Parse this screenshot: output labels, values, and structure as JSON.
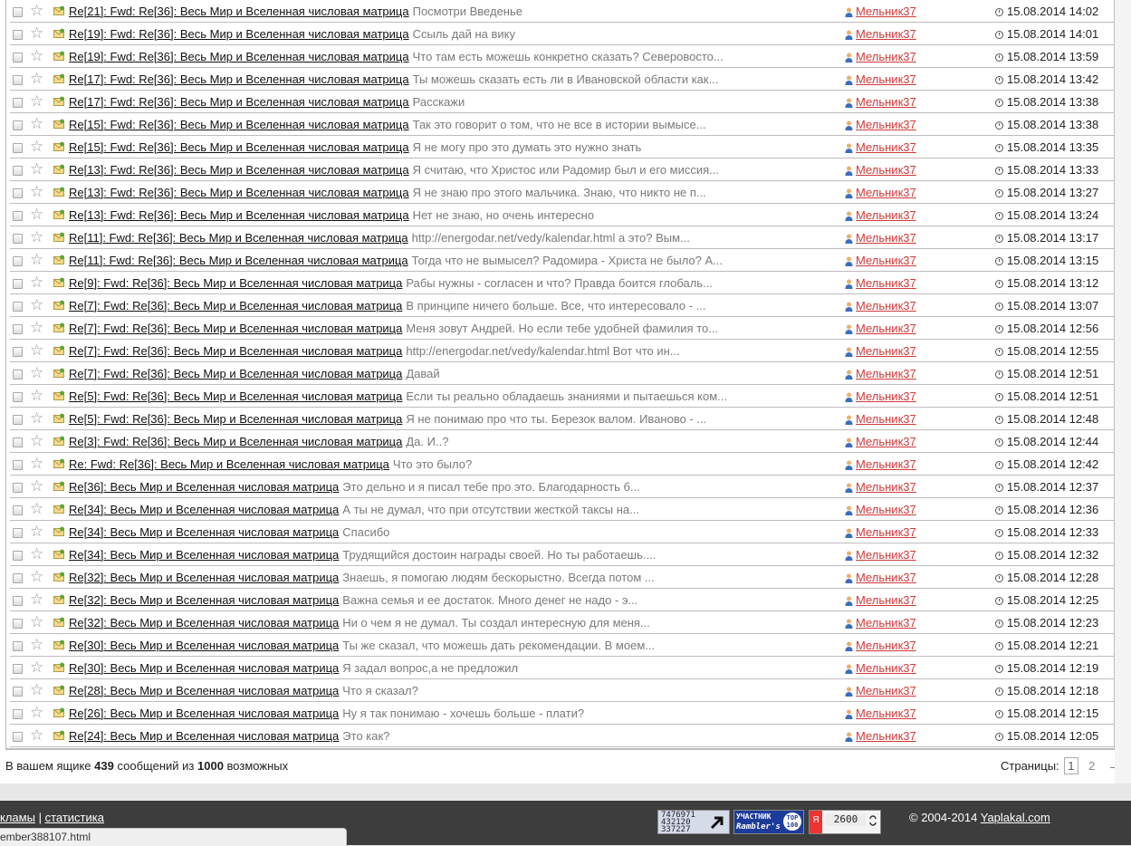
{
  "messages": [
    {
      "subject": "Re[21]: Fwd: Re[36]: Весь Мир и Вселенная числовая матрица",
      "preview": "Посмотри Введенье",
      "author": "Мельник37",
      "date": "15.08.2014 14:02"
    },
    {
      "subject": "Re[19]: Fwd: Re[36]: Весь Мир и Вселенная числовая матрица",
      "preview": "Ссыль дай на вику",
      "author": "Мельник37",
      "date": "15.08.2014 14:01"
    },
    {
      "subject": "Re[19]: Fwd: Re[36]: Весь Мир и Вселенная числовая матрица",
      "preview": "Что там есть можешь конкретно сказать? Северовосто...",
      "author": "Мельник37",
      "date": "15.08.2014 13:59"
    },
    {
      "subject": "Re[17]: Fwd: Re[36]: Весь Мир и Вселенная числовая матрица",
      "preview": "Ты можешь сказать есть ли в Ивановской области как...",
      "author": "Мельник37",
      "date": "15.08.2014 13:42"
    },
    {
      "subject": "Re[17]: Fwd: Re[36]: Весь Мир и Вселенная числовая матрица",
      "preview": "Расскажи",
      "author": "Мельник37",
      "date": "15.08.2014 13:38"
    },
    {
      "subject": "Re[15]: Fwd: Re[36]: Весь Мир и Вселенная числовая матрица",
      "preview": "Так это говорит о том, что не все в истории вымысе...",
      "author": "Мельник37",
      "date": "15.08.2014 13:38"
    },
    {
      "subject": "Re[15]: Fwd: Re[36]: Весь Мир и Вселенная числовая матрица",
      "preview": "Я не могу про это думать это нужно знать",
      "author": "Мельник37",
      "date": "15.08.2014 13:35"
    },
    {
      "subject": "Re[13]: Fwd: Re[36]: Весь Мир и Вселенная числовая матрица",
      "preview": "Я считаю, что Христос или Радомир был и его миссия...",
      "author": "Мельник37",
      "date": "15.08.2014 13:33"
    },
    {
      "subject": "Re[13]: Fwd: Re[36]: Весь Мир и Вселенная числовая матрица",
      "preview": "Я не знаю про этого мальчика. Знаю, что никто не п...",
      "author": "Мельник37",
      "date": "15.08.2014 13:27"
    },
    {
      "subject": "Re[13]: Fwd: Re[36]: Весь Мир и Вселенная числовая матрица",
      "preview": "Нет не знаю, но очень интересно",
      "author": "Мельник37",
      "date": "15.08.2014 13:24"
    },
    {
      "subject": "Re[11]: Fwd: Re[36]: Весь Мир и Вселенная числовая матрица",
      "preview": "http://energodar.net/vedy/kalendar.html а это? Вым...",
      "author": "Мельник37",
      "date": "15.08.2014 13:17"
    },
    {
      "subject": "Re[11]: Fwd: Re[36]: Весь Мир и Вселенная числовая матрица",
      "preview": "Тогда что не вымысел? Радомира - Христа не было? А...",
      "author": "Мельник37",
      "date": "15.08.2014 13:15"
    },
    {
      "subject": "Re[9]: Fwd: Re[36]: Весь Мир и Вселенная числовая матрица",
      "preview": "Рабы нужны - согласен и что? Правда боится глобаль...",
      "author": "Мельник37",
      "date": "15.08.2014 13:12"
    },
    {
      "subject": "Re[7]: Fwd: Re[36]: Весь Мир и Вселенная числовая матрица",
      "preview": "В принципе ничего больше. Все, что интересовало - ...",
      "author": "Мельник37",
      "date": "15.08.2014 13:07"
    },
    {
      "subject": "Re[7]: Fwd: Re[36]: Весь Мир и Вселенная числовая матрица",
      "preview": "Меня зовут Андрей. Но если тебе удобней фамилия то...",
      "author": "Мельник37",
      "date": "15.08.2014 12:56"
    },
    {
      "subject": "Re[7]: Fwd: Re[36]: Весь Мир и Вселенная числовая матрица",
      "preview": "http://energodar.net/vedy/kalendar.html Вот что ин...",
      "author": "Мельник37",
      "date": "15.08.2014 12:55"
    },
    {
      "subject": "Re[7]: Fwd: Re[36]: Весь Мир и Вселенная числовая матрица",
      "preview": "Давай",
      "author": "Мельник37",
      "date": "15.08.2014 12:51"
    },
    {
      "subject": "Re[5]: Fwd: Re[36]: Весь Мир и Вселенная числовая матрица",
      "preview": "Если ты реально обладаешь знаниями и пытаешься ком...",
      "author": "Мельник37",
      "date": "15.08.2014 12:51"
    },
    {
      "subject": "Re[5]: Fwd: Re[36]: Весь Мир и Вселенная числовая матрица",
      "preview": "Я не понимаю про что ты. Березок валом. Иваново - ...",
      "author": "Мельник37",
      "date": "15.08.2014 12:48"
    },
    {
      "subject": "Re[3]: Fwd: Re[36]: Весь Мир и Вселенная числовая матрица",
      "preview": "Да. И..?",
      "author": "Мельник37",
      "date": "15.08.2014 12:44"
    },
    {
      "subject": "Re: Fwd: Re[36]: Весь Мир и Вселенная числовая матрица",
      "preview": "Что это было?",
      "author": "Мельник37",
      "date": "15.08.2014 12:42"
    },
    {
      "subject": "Re[36]: Весь Мир и Вселенная числовая матрица",
      "preview": "Это дельно и я писал тебе про это. Благодарность б...",
      "author": "Мельник37",
      "date": "15.08.2014 12:37"
    },
    {
      "subject": "Re[34]: Весь Мир и Вселенная числовая матрица",
      "preview": "А ты не думал, что при отсутствии жесткой таксы на...",
      "author": "Мельник37",
      "date": "15.08.2014 12:36"
    },
    {
      "subject": "Re[34]: Весь Мир и Вселенная числовая матрица",
      "preview": "Спасибо",
      "author": "Мельник37",
      "date": "15.08.2014 12:33"
    },
    {
      "subject": "Re[34]: Весь Мир и Вселенная числовая матрица",
      "preview": "Трудящийся достоин награды своей. Но ты работаешь....",
      "author": "Мельник37",
      "date": "15.08.2014 12:32"
    },
    {
      "subject": "Re[32]: Весь Мир и Вселенная числовая матрица",
      "preview": "Знаешь, я помогаю людям бескорыстно. Всегда потом ...",
      "author": "Мельник37",
      "date": "15.08.2014 12:28"
    },
    {
      "subject": "Re[32]: Весь Мир и Вселенная числовая матрица",
      "preview": "Важна семья и ее достаток. Много денег не надо - э...",
      "author": "Мельник37",
      "date": "15.08.2014 12:25"
    },
    {
      "subject": "Re[32]: Весь Мир и Вселенная числовая матрица",
      "preview": "Ни о чем я не думал. Ты создал интересную для меня...",
      "author": "Мельник37",
      "date": "15.08.2014 12:23"
    },
    {
      "subject": "Re[30]: Весь Мир и Вселенная числовая матрица",
      "preview": "Ты же сказал, что можешь дать рекомендации. В моем...",
      "author": "Мельник37",
      "date": "15.08.2014 12:21"
    },
    {
      "subject": "Re[30]: Весь Мир и Вселенная числовая матрица",
      "preview": "Я задал вопрос,а не предложил",
      "author": "Мельник37",
      "date": "15.08.2014 12:19"
    },
    {
      "subject": "Re[28]: Весь Мир и Вселенная числовая матрица",
      "preview": "Что я сказал?",
      "author": "Мельник37",
      "date": "15.08.2014 12:18"
    },
    {
      "subject": "Re[26]: Весь Мир и Вселенная числовая матрица",
      "preview": "Ну я так понимаю - хочешь больше - плати?",
      "author": "Мельник37",
      "date": "15.08.2014 12:15"
    },
    {
      "subject": "Re[24]: Весь Мир и Вселенная числовая матрица",
      "preview": "Это как?",
      "author": "Мельник37",
      "date": "15.08.2014 12:05"
    }
  ],
  "summary": {
    "prefix": "В вашем ящике",
    "count": "439",
    "middle": "сообщений из",
    "max": "1000",
    "suffix": "возможных"
  },
  "pagination": {
    "label": "Страницы:",
    "current": "1",
    "next_page": "2",
    "arrow": "→"
  },
  "footer": {
    "link_ads": "кламы",
    "separator": "|",
    "link_stats": "статистика",
    "copyright": "© 2004-2014",
    "site_link": "Yaplakal.com",
    "badge_counter_lines": [
      "7476971",
      "432120",
      "337227"
    ],
    "badge_rambler_top": "УЧАСТНИК",
    "badge_rambler_name": "Rambler's",
    "badge_rambler_top100": "TOP 100",
    "badge_ya_letter": "Я",
    "badge_ya_value": "2600"
  },
  "status_bar": {
    "url": "ember388107.html"
  },
  "colors": {
    "author_link": "#d03a3a",
    "preview_text": "#7a7a7a",
    "footer_bg": "#3d3d3d"
  }
}
